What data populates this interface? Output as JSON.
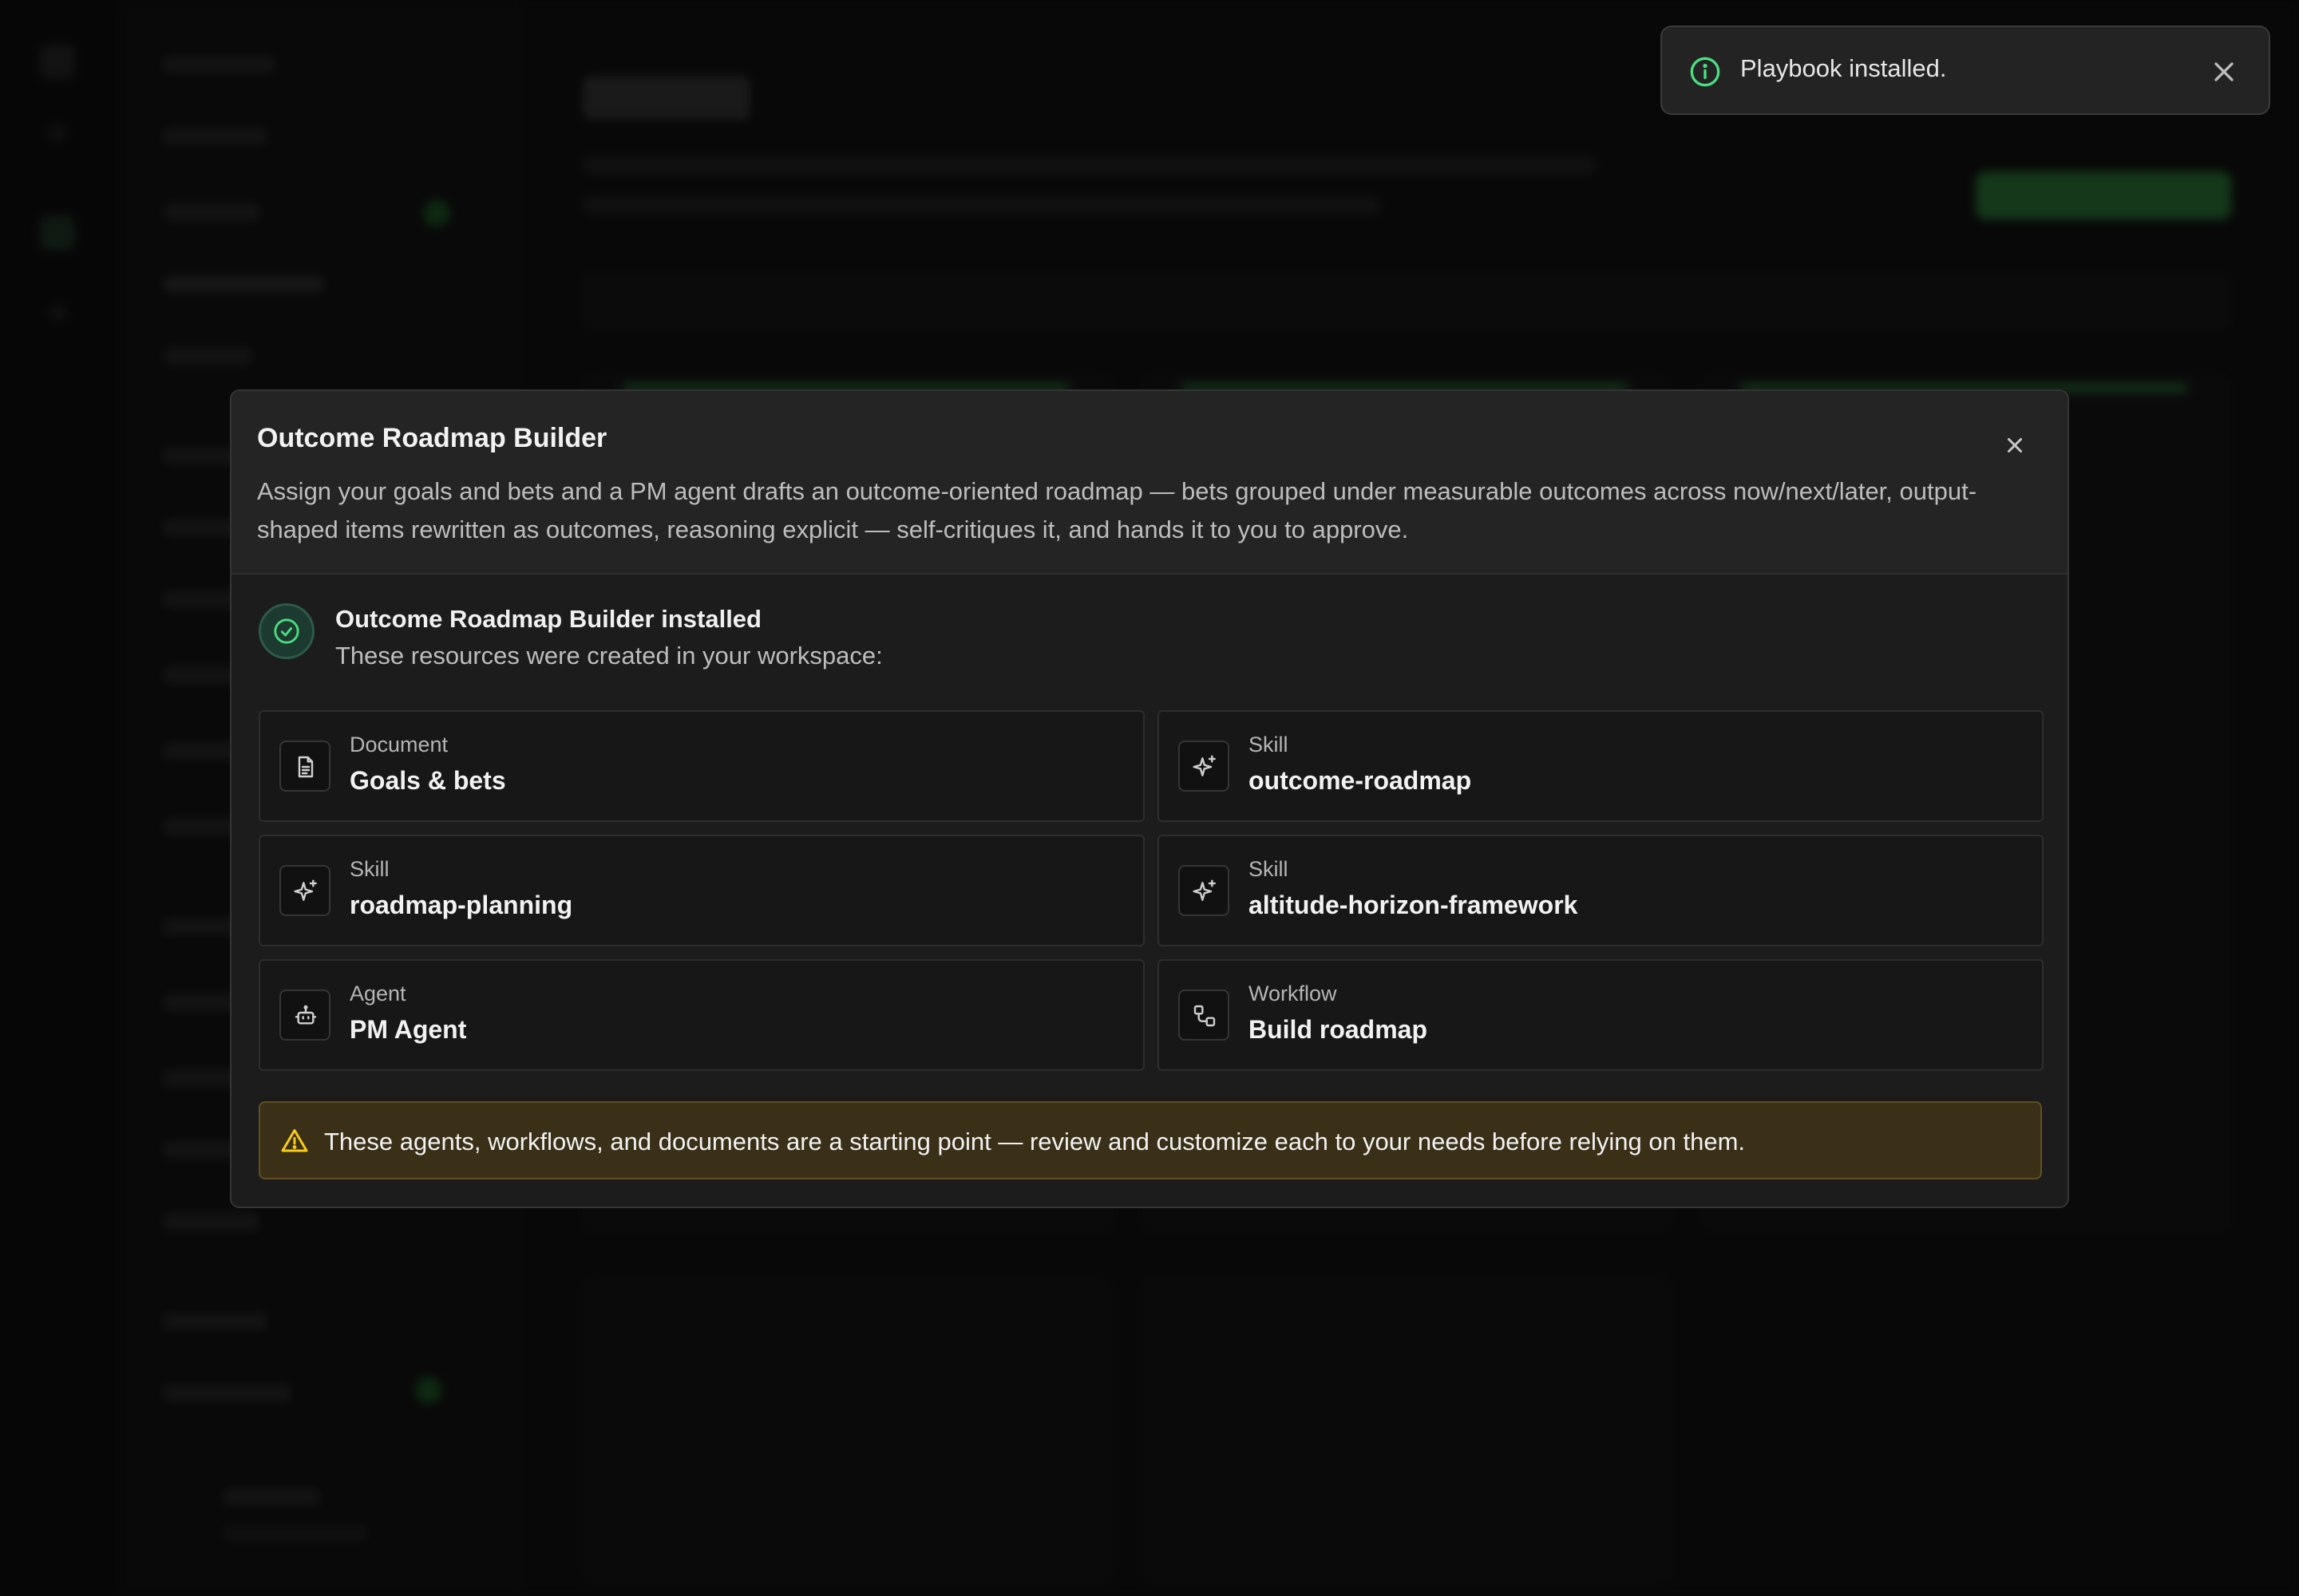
{
  "toast": {
    "icon": "info-icon",
    "message": "Playbook installed.",
    "close_icon": "close-icon"
  },
  "modal": {
    "title": "Outcome Roadmap Builder",
    "description": "Assign your goals and bets and a PM agent drafts an outcome-oriented roadmap — bets grouped under measurable outcomes across now/next/later, output-shaped items rewritten as outcomes, reasoning explicit — self-critiques it, and hands it to you to approve.",
    "close_icon": "close-icon",
    "success": {
      "title": "Outcome Roadmap Builder installed",
      "subtitle": "These resources were created in your workspace:"
    },
    "resources": [
      {
        "type": "Document",
        "name": "Goals & bets",
        "icon": "document-icon"
      },
      {
        "type": "Skill",
        "name": "outcome-roadmap",
        "icon": "sparkle-icon"
      },
      {
        "type": "Skill",
        "name": "roadmap-planning",
        "icon": "sparkle-icon"
      },
      {
        "type": "Skill",
        "name": "altitude-horizon-framework",
        "icon": "sparkle-icon"
      },
      {
        "type": "Agent",
        "name": "PM Agent",
        "icon": "robot-icon"
      },
      {
        "type": "Workflow",
        "name": "Build roadmap",
        "icon": "workflow-icon"
      }
    ],
    "warning": "These agents, workflows, and documents are a starting point — review and customize each to your needs before relying on them."
  },
  "colors": {
    "accent_green": "#4ade80",
    "warning_bg": "#3a3018",
    "warning_icon": "#facc15"
  }
}
